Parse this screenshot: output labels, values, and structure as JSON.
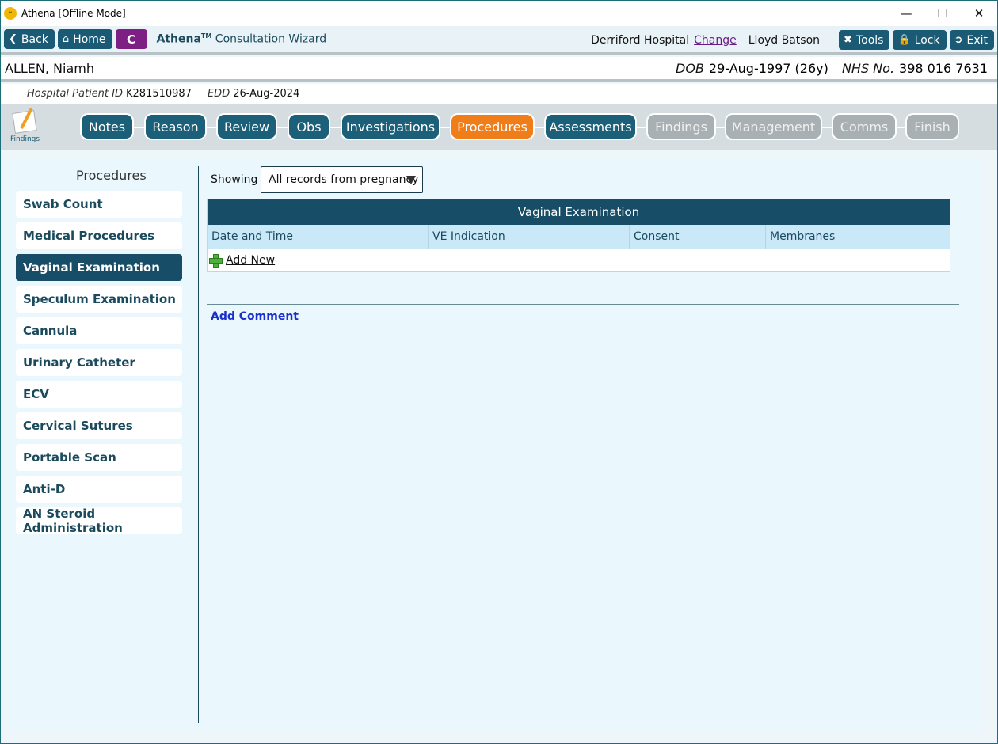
{
  "window": {
    "title": "Athena [Offline Mode]"
  },
  "toolbar": {
    "back_label": "Back",
    "home_label": "Home",
    "c_label": "C",
    "brand_name": "Athena",
    "brand_tm": "TM",
    "brand_rest": "Consultation Wizard",
    "hospital": "Derriford Hospital",
    "change_label": "Change",
    "user": "Lloyd Batson",
    "tools_label": "Tools",
    "lock_label": "Lock",
    "exit_label": "Exit"
  },
  "patient": {
    "name": "ALLEN, Niamh",
    "dob_label": "DOB",
    "dob_value": "29-Aug-1997 (26y)",
    "nhs_label": "NHS No.",
    "nhs_value": "398 016 7631",
    "hospital_id_label": "Hospital Patient ID",
    "hospital_id_value": "K281510987",
    "edd_label": "EDD",
    "edd_value": "26-Aug-2024"
  },
  "steps": {
    "findings_icon_label": "Findings",
    "items": [
      {
        "label": "Notes",
        "state": "done"
      },
      {
        "label": "Reason",
        "state": "done"
      },
      {
        "label": "Review",
        "state": "done"
      },
      {
        "label": "Obs",
        "state": "done"
      },
      {
        "label": "Investigations",
        "state": "done"
      },
      {
        "label": "Procedures",
        "state": "active"
      },
      {
        "label": "Assessments",
        "state": "done"
      },
      {
        "label": "Findings",
        "state": "disabled"
      },
      {
        "label": "Management",
        "state": "disabled"
      },
      {
        "label": "Comms",
        "state": "disabled"
      },
      {
        "label": "Finish",
        "state": "disabled"
      }
    ]
  },
  "sidebar": {
    "title": "Procedures",
    "items": [
      {
        "label": "Swab Count"
      },
      {
        "label": "Medical Procedures"
      },
      {
        "label": "Vaginal Examination",
        "selected": true
      },
      {
        "label": "Speculum Examination"
      },
      {
        "label": "Cannula"
      },
      {
        "label": "Urinary Catheter"
      },
      {
        "label": "ECV"
      },
      {
        "label": "Cervical Sutures"
      },
      {
        "label": "Portable Scan"
      },
      {
        "label": "Anti-D"
      },
      {
        "label": "AN Steroid Administration"
      }
    ]
  },
  "main": {
    "showing_label": "Showing",
    "filter_value": "All records from pregnancy",
    "table": {
      "title": "Vaginal Examination",
      "columns": [
        "Date and Time",
        "VE Indication",
        "Consent",
        "Membranes"
      ],
      "add_new_label": "Add New"
    },
    "add_comment_label": "Add Comment"
  },
  "colors": {
    "primary": "#1b5f78",
    "active_step": "#ef7d1a",
    "disabled_step": "#a9b0b3",
    "c_button": "#7e1f86",
    "selected_sidebar": "#174d66"
  }
}
